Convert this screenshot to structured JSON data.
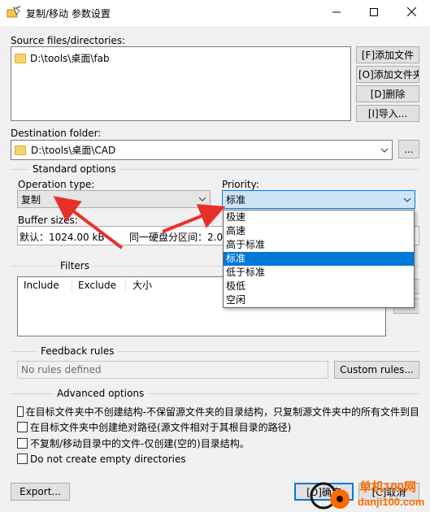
{
  "window": {
    "title": "复制/移动 参数设置"
  },
  "source": {
    "label": "Source files/directories:",
    "items": [
      "D:\\tools\\桌面\\fab"
    ],
    "buttons": {
      "add_file": "[F]添加文件",
      "add_folder": "[O]添加文件夹",
      "delete": "[D]删除",
      "import": "[I]导入..."
    }
  },
  "destination": {
    "label": "Destination folder:",
    "value": "D:\\tools\\桌面\\CAD",
    "browse_label": "..."
  },
  "standard": {
    "title": "Standard options",
    "operation_label": "Operation type:",
    "operation_value": "复制",
    "priority_label": "Priority:",
    "priority_value": "标准",
    "buffer_label": "Buffer sizes:",
    "buffer_default": "默认：1024.00 kB",
    "buffer_same_disk": "同一硬盘分区间：2.0"
  },
  "priority_options": [
    "极速",
    "高速",
    "高于标准",
    "标准",
    "低于标准",
    "极低",
    "空闲"
  ],
  "priority_selected_index": 3,
  "filters": {
    "title": "Filters",
    "columns": [
      "Include",
      "Exclude",
      "大小"
    ]
  },
  "feedback": {
    "title": "Feedback rules",
    "value": "No rules defined",
    "custom_label": "Custom rules..."
  },
  "advanced": {
    "title": "Advanced options",
    "options": [
      "在目标文件夹中不创建结构-不保留源文件夹的目录结构，只复制源文件夹中的所有文件到目",
      "在目标文件夹中创建绝对路径(源文件相对于其根目录的路径)",
      "不复制/移动目录中的文件-仅创建(空的)目录结构。",
      "Do not create empty directories"
    ]
  },
  "footer": {
    "export_label": "Export...",
    "ok_label": "[O]确定",
    "cancel_label": "[C]取消"
  },
  "watermark": {
    "line1": "单机100网",
    "line2": "danji100.com"
  },
  "colors": {
    "accent": "#0078d7",
    "annotation_arrow": "#e8302a",
    "watermark": "#ff6a00"
  }
}
